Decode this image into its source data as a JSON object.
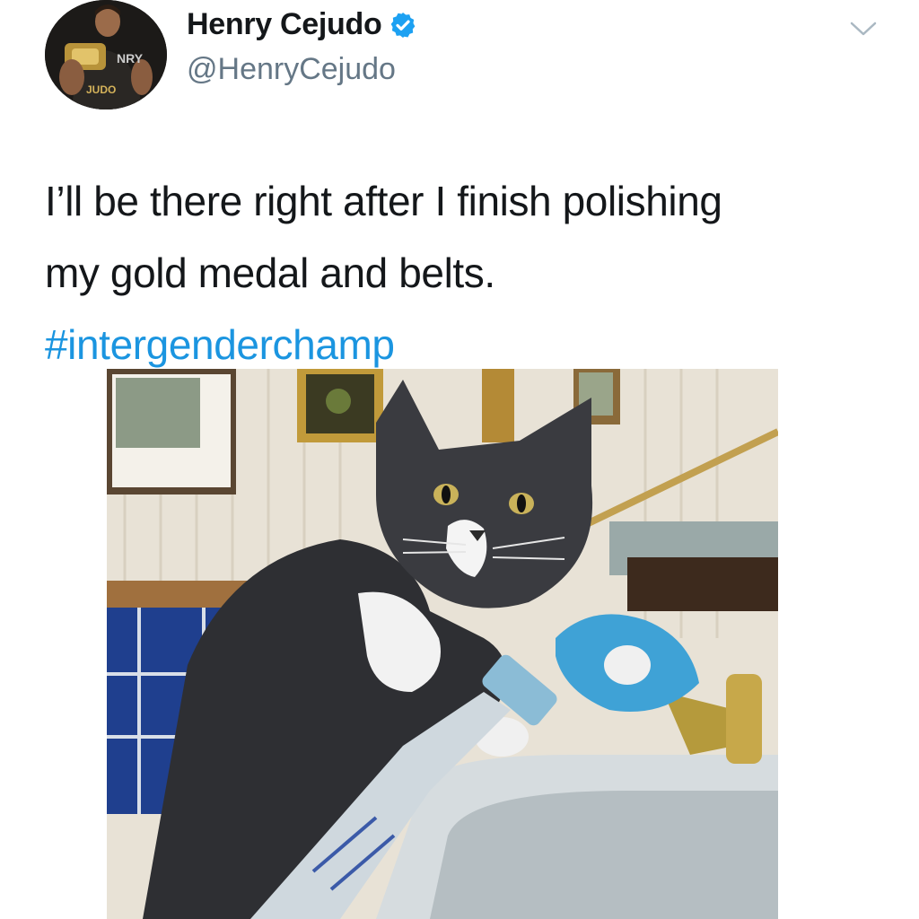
{
  "author": {
    "display_name": "Henry Cejudo",
    "handle": "@HenryCejudo",
    "verified": true,
    "avatar_text": "JUDO"
  },
  "tweet": {
    "text_line1": "I’ll be there right after I finish polishing",
    "text_line2": "my gold medal and belts.",
    "hashtag": "#intergenderchamp"
  },
  "media": {
    "alt": "cat cleaning a sink with a spray bottle and blue cloth"
  },
  "icons": {
    "verified": "verified-badge-icon",
    "caret": "chevron-down-icon"
  },
  "colors": {
    "text": "#14171a",
    "muted": "#657786",
    "link": "#1b95e0",
    "verified": "#1da1f2"
  }
}
